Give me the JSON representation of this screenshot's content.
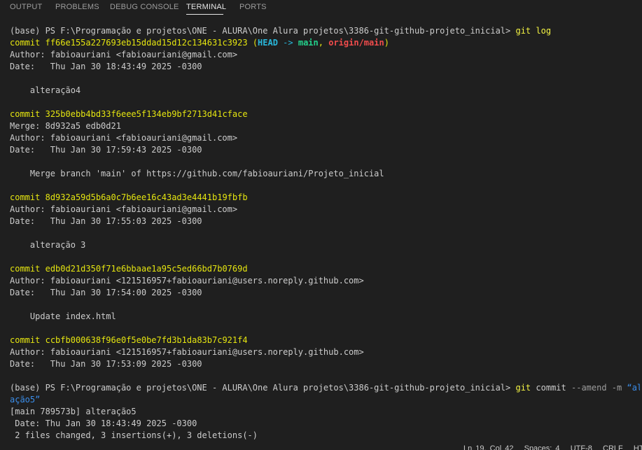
{
  "panel_tabs": [
    "OUTPUT",
    "PROBLEMS",
    "DEBUG CONSOLE",
    "TERMINAL",
    "PORTS"
  ],
  "active_tab": "TERMINAL",
  "terminal": {
    "prompt1": "(base) PS F:\\Programação e projetos\\ONE - ALURA\\One Alura projetos\\3386-git-github-projeto_inicial>",
    "command1": "git log",
    "commits": [
      {
        "commit_label": "commit",
        "hash": "ff66e155a227693eb15ddad15d12c134631c3923",
        "refs": {
          "open": "(",
          "head": "HEAD -> main",
          "sep": ", ",
          "origin": "origin/main",
          "close": ")"
        },
        "author": "Author: fabioauriani <fabioauriani@gmail.com>",
        "date": "Date:   Thu Jan 30 18:43:49 2025 -0300",
        "message": "    alteração4"
      },
      {
        "commit_label": "commit",
        "hash": "325b0ebb4bd33f6eee5f134eb9bf2713d41cface",
        "merge": "Merge: 8d932a5 edb0d21",
        "author": "Author: fabioauriani <fabioauriani@gmail.com>",
        "date": "Date:   Thu Jan 30 17:59:43 2025 -0300",
        "message": "    Merge branch 'main' of https://github.com/fabioauriani/Projeto_inicial"
      },
      {
        "commit_label": "commit",
        "hash": "8d932a59d5b6a0c7b6ee16c43ad3e4441b19fbfb",
        "author": "Author: fabioauriani <fabioauriani@gmail.com>",
        "date": "Date:   Thu Jan 30 17:55:03 2025 -0300",
        "message": "    alteração 3"
      },
      {
        "commit_label": "commit",
        "hash": "edb0d21d350f71e6bbaae1a95c5ed66bd7b0769d",
        "author": "Author: fabioauriani <121516957+fabioauriani@users.noreply.github.com>",
        "date": "Date:   Thu Jan 30 17:54:00 2025 -0300",
        "message": "    Update index.html"
      },
      {
        "commit_label": "commit",
        "hash": "ccbfb000638f96e0f5e0be7fd3b1da83b7c921f4",
        "author": "Author: fabioauriani <121516957+fabioauriani@users.noreply.github.com>",
        "date": "Date:   Thu Jan 30 17:53:09 2025 -0300"
      }
    ],
    "prompt2": "(base) PS F:\\Programação e projetos\\ONE - ALURA\\One Alura projetos\\3386-git-github-projeto_inicial>",
    "command2_git": "git",
    "command2_sub": "commit",
    "command2_flags": "--amend -m",
    "command2_str_a": "“alter",
    "command2_str_b": "ação5”",
    "output": [
      "[main 789573b] alteração5",
      " Date: Thu Jan 30 18:43:49 2025 -0300",
      " 2 files changed, 3 insertions(+), 3 deletions(-)"
    ]
  },
  "status_bar": "Ln 19, Col 42   Spaces: 4   UTF-8   CRLF   HT"
}
